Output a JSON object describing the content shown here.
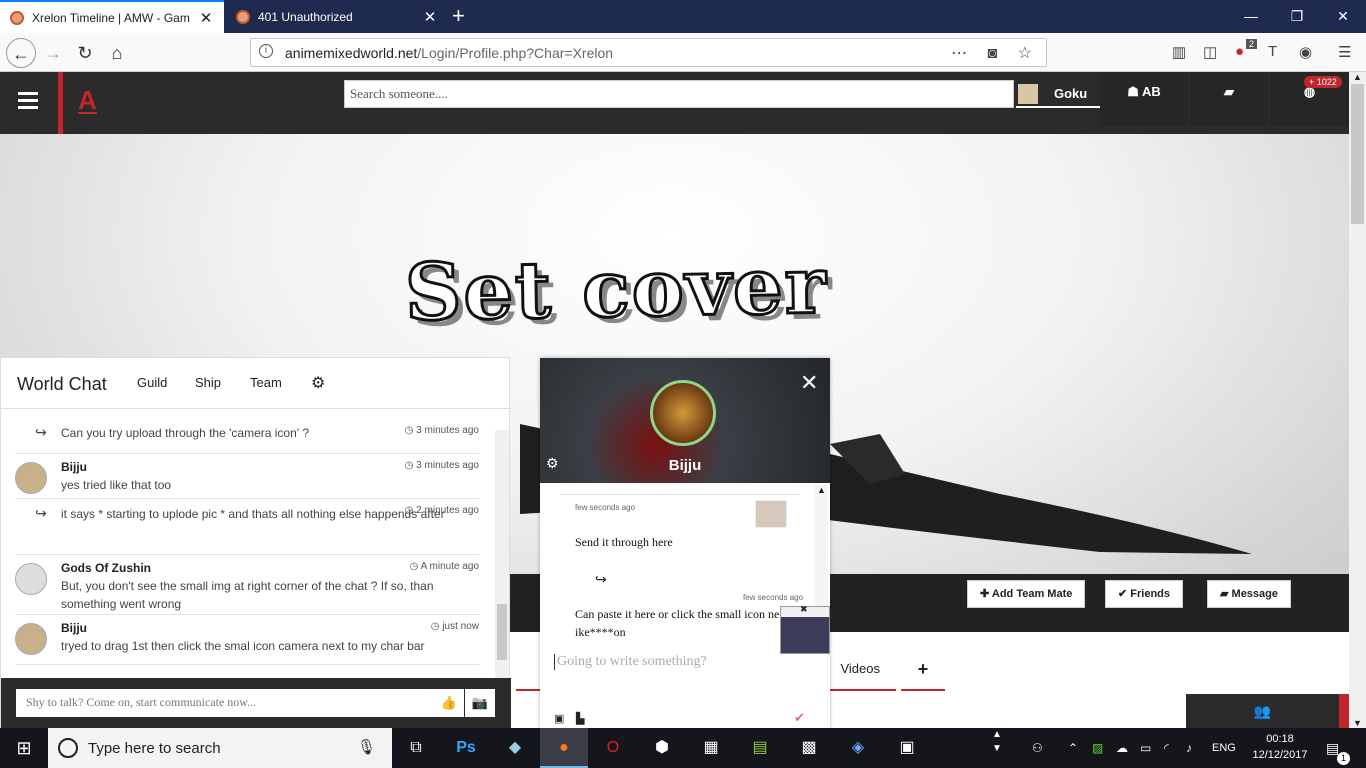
{
  "browser": {
    "tabs": [
      {
        "title": "Xrelon Timeline | AMW - Game"
      },
      {
        "title": "401 Unauthorized"
      }
    ],
    "url_prefix": "animemixedworld.net",
    "url_path": "/Login/Profile.php?Char=Xrelon",
    "addon_badge": "2"
  },
  "header": {
    "logo": "A",
    "search_placeholder": "Search someone....",
    "user_name": "Goku",
    "ab_label": "AB",
    "notif_count": "+ 1022"
  },
  "cover": {
    "title": "Set cover",
    "buttons": [
      "Add Team Mate",
      "Friends",
      "Message"
    ]
  },
  "profile_nav": {
    "videos_label": "Videos",
    "add_label": "+"
  },
  "world_chat": {
    "title": "World Chat",
    "tabs": [
      "Guild",
      "Ship",
      "Team"
    ],
    "messages": [
      {
        "reply": true,
        "name": "",
        "time": "3 minutes ago",
        "text": "Can you try upload through the 'camera icon' ?"
      },
      {
        "reply": false,
        "name": "Bijju",
        "time": "3 minutes ago",
        "text": "yes tried like that too"
      },
      {
        "reply": true,
        "name": "",
        "time": "2 minutes ago",
        "text": "it says * starting to uplode pic * and thats all nothing else happends after"
      },
      {
        "reply": false,
        "name": "Gods Of Zushin",
        "time": "A minute ago",
        "text": "But, you don't see the small img at right corner of the chat ? If so, than something went wrong"
      },
      {
        "reply": false,
        "name": "Bijju",
        "time": "just now",
        "text": "tryed to drag 1st then click the smal icon camera next to my char bar"
      }
    ],
    "input_placeholder": "Shy to talk? Come on, start communicate now..."
  },
  "profile_popup": {
    "name": "Bijju",
    "messages": [
      {
        "time": "few seconds ago",
        "text": "Send it through here"
      },
      {
        "time": "few seconds ago",
        "text": "Can paste it here or click the small icon ne ike****on"
      }
    ],
    "input_placeholder": "Going to write something?"
  },
  "taskbar": {
    "search_placeholder": "Type here to search",
    "language": "ENG",
    "time": "00:18",
    "date": "12/12/2017",
    "notification_count": "1"
  }
}
